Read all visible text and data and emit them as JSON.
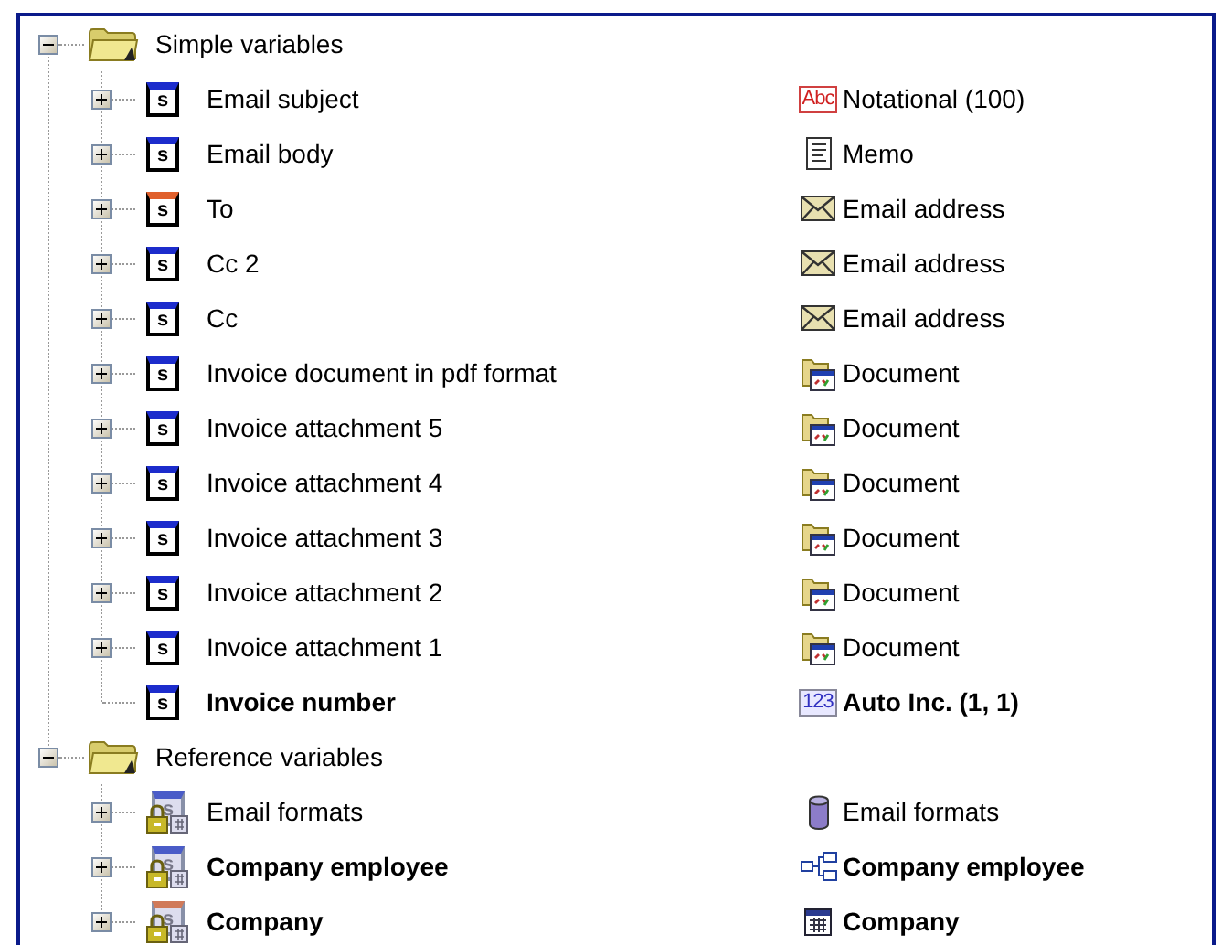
{
  "groups": [
    {
      "label": "Simple variables",
      "expanded": true,
      "children": [
        {
          "kind": "simple",
          "icon_letter": "s",
          "color": "#1c2ccc",
          "name": "Email subject",
          "bold": false,
          "expandable": true,
          "type": {
            "kind": "notational",
            "icon_text": "Abc",
            "label": "Notational (100)"
          }
        },
        {
          "kind": "simple",
          "icon_letter": "s",
          "color": "#1c2ccc",
          "name": "Email body",
          "bold": false,
          "expandable": true,
          "type": {
            "kind": "memo",
            "label": "Memo"
          }
        },
        {
          "kind": "simple",
          "icon_letter": "s",
          "color": "#e0602c",
          "name": "To",
          "bold": false,
          "expandable": true,
          "type": {
            "kind": "email",
            "label": "Email address"
          }
        },
        {
          "kind": "simple",
          "icon_letter": "s",
          "color": "#1c2ccc",
          "name": "Cc 2",
          "bold": false,
          "expandable": true,
          "type": {
            "kind": "email",
            "label": "Email address"
          }
        },
        {
          "kind": "simple",
          "icon_letter": "s",
          "color": "#1c2ccc",
          "name": "Cc",
          "bold": false,
          "expandable": true,
          "type": {
            "kind": "email",
            "label": "Email address"
          }
        },
        {
          "kind": "simple",
          "icon_letter": "s",
          "color": "#1c2ccc",
          "name": "Invoice document in pdf format",
          "bold": false,
          "expandable": true,
          "type": {
            "kind": "document",
            "label": "Document"
          }
        },
        {
          "kind": "simple",
          "icon_letter": "s",
          "color": "#1c2ccc",
          "name": "Invoice attachment 5",
          "bold": false,
          "expandable": true,
          "type": {
            "kind": "document",
            "label": "Document"
          }
        },
        {
          "kind": "simple",
          "icon_letter": "s",
          "color": "#1c2ccc",
          "name": "Invoice attachment 4",
          "bold": false,
          "expandable": true,
          "type": {
            "kind": "document",
            "label": "Document"
          }
        },
        {
          "kind": "simple",
          "icon_letter": "s",
          "color": "#1c2ccc",
          "name": "Invoice attachment 3",
          "bold": false,
          "expandable": true,
          "type": {
            "kind": "document",
            "label": "Document"
          }
        },
        {
          "kind": "simple",
          "icon_letter": "s",
          "color": "#1c2ccc",
          "name": "Invoice attachment 2",
          "bold": false,
          "expandable": true,
          "type": {
            "kind": "document",
            "label": "Document"
          }
        },
        {
          "kind": "simple",
          "icon_letter": "s",
          "color": "#1c2ccc",
          "name": "Invoice attachment 1",
          "bold": false,
          "expandable": true,
          "type": {
            "kind": "document",
            "label": "Document"
          }
        },
        {
          "kind": "simple",
          "icon_letter": "s",
          "color": "#1c2ccc",
          "name": "Invoice number",
          "bold": true,
          "expandable": false,
          "type": {
            "kind": "autoinc",
            "icon_text": "123",
            "label": "Auto Inc. (1, 1)"
          }
        }
      ]
    },
    {
      "label": "Reference variables",
      "expanded": true,
      "children": [
        {
          "kind": "reference",
          "icon_letter": "s",
          "color": "#4a5cc8",
          "name": "Email formats",
          "bold": false,
          "expandable": true,
          "type": {
            "kind": "database",
            "label": "Email formats"
          }
        },
        {
          "kind": "reference",
          "icon_letter": "s",
          "color": "#4a5cc8",
          "name": "Company employee",
          "bold": true,
          "expandable": true,
          "type": {
            "kind": "relation",
            "label": "Company employee"
          }
        },
        {
          "kind": "reference",
          "icon_letter": "s",
          "color": "#d07a5a",
          "name": "Company",
          "bold": true,
          "expandable": true,
          "type": {
            "kind": "grid",
            "label": "Company"
          }
        }
      ]
    }
  ]
}
